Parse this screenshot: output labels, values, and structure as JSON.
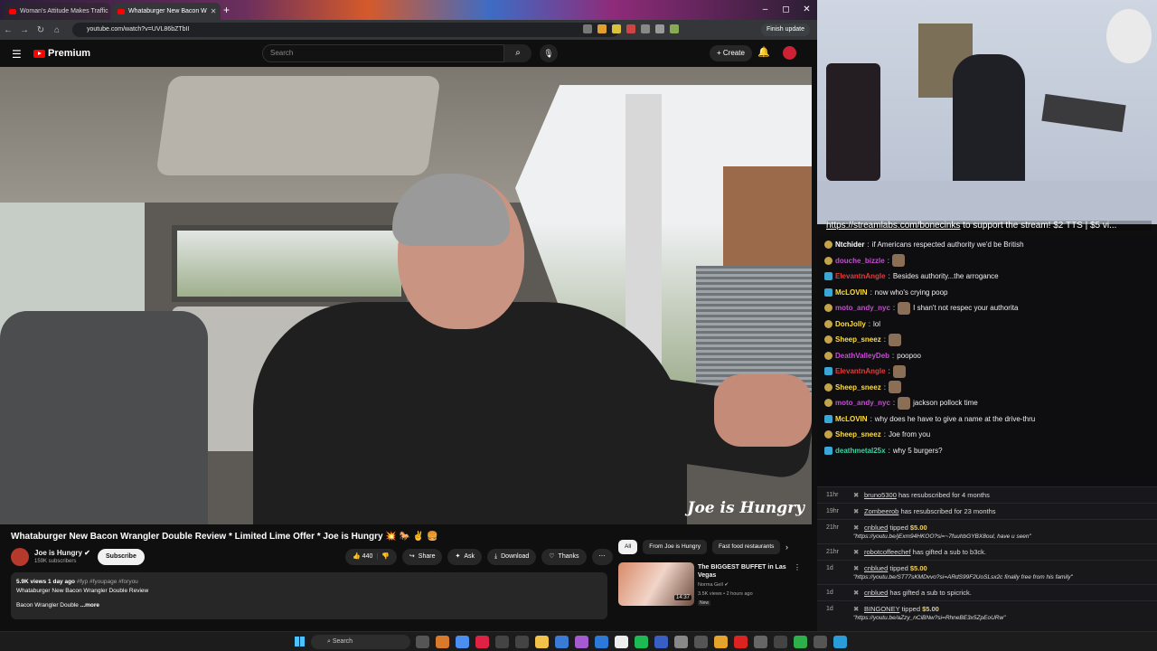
{
  "browser": {
    "tabs": [
      {
        "label": "Woman's Attitude Makes Traffic",
        "active": false
      },
      {
        "label": "Whataburger New Bacon W",
        "active": true
      }
    ],
    "url": "youtube.com/watch?v=UVL86bZTbII",
    "finish_update": "Finish update"
  },
  "youtube": {
    "brand": "Premium",
    "search_placeholder": "Search",
    "create_label": "Create",
    "video": {
      "watermark": "Joe is Hungry",
      "title": "Whataburger New Bacon Wrangler Double Review * Limited Lime Offer * Joe is Hungry 💥 🐎 ✌ 🍔",
      "channel": "Joe is Hungry",
      "subscribers": "159K subscribers",
      "subscribe_label": "Subscribe",
      "likes": "440",
      "share_label": "Share",
      "ask_label": "Ask",
      "download_label": "Download",
      "thanks_label": "Thanks",
      "views_line": "5.9K views  1 day ago",
      "hashtags": "#fyp #fyoupage #foryou",
      "desc_line1": "Whataburger New Bacon Wrangler Double Review",
      "desc_line2": "Bacon Wrangler Double",
      "more_label": "...more"
    },
    "chips": [
      "All",
      "From Joe is Hungry",
      "Fast food restaurants"
    ],
    "recommendation": {
      "title": "The BIGGEST BUFFET in Las Vegas",
      "channel": "Norma Gell",
      "views": "3.5K views • 2 hours ago",
      "badge": "New",
      "duration": "14:37"
    }
  },
  "stream": {
    "ticker_link": "https://streamlabs.com/bonecinks",
    "ticker_text": " to support the stream! $2 TTS | $5 vi..."
  },
  "chat": [
    {
      "user": "Ntchider",
      "color": "#ffffff",
      "badge": "b1",
      "text": "if Americans respected authority we'd be British"
    },
    {
      "user": "douche_bizzle",
      "color": "#c94bd6",
      "badge": "b1",
      "text": "",
      "emote": true
    },
    {
      "user": "ElevantnAngle",
      "color": "#e23c3c",
      "badge": "b2",
      "text": "Besides authority...the arrogance"
    },
    {
      "user": "McLOVIN",
      "color": "#ffdf3a",
      "badge": "b2",
      "text": "now who's crying poop"
    },
    {
      "user": "moto_andy_nyc",
      "color": "#c94bd6",
      "badge": "b1",
      "text": "I shan't not respec your authorita",
      "emote": true
    },
    {
      "user": "DonJolly",
      "color": "#ffdf3a",
      "badge": "b1",
      "text": "lol"
    },
    {
      "user": "Sheep_sneez",
      "color": "#ffdf3a",
      "badge": "b1",
      "text": "",
      "emote": true
    },
    {
      "user": "DeathValleyDeb",
      "color": "#c94bd6",
      "badge": "b1",
      "text": "poopoo"
    },
    {
      "user": "ElevantnAngle",
      "color": "#e23c3c",
      "badge": "b2",
      "text": "",
      "emote": true
    },
    {
      "user": "Sheep_sneez",
      "color": "#ffdf3a",
      "badge": "b1",
      "text": "",
      "emote": true
    },
    {
      "user": "moto_andy_nyc",
      "color": "#c94bd6",
      "badge": "b1",
      "text": "jackson pollock time",
      "emote": true
    },
    {
      "user": "McLOVIN",
      "color": "#ffdf3a",
      "badge": "b2",
      "text": "why does he have to give a name at the drive-thru"
    },
    {
      "user": "Sheep_sneez",
      "color": "#ffdf3a",
      "badge": "b1",
      "text": "Joe from you"
    },
    {
      "user": "deathmetal25x",
      "color": "#3ad6a0",
      "badge": "b2",
      "text": "why 5 burgers?"
    }
  ],
  "events": [
    {
      "time": "11hr",
      "user": "bruno5300",
      "text": " has resubscribed for 4 months"
    },
    {
      "time": "19hr",
      "user": "Zombeerob",
      "text": " has resubscribed for 23 months"
    },
    {
      "time": "21hr",
      "user": "cnblued",
      "text": " tipped ",
      "amount": "$5.00",
      "note": "\"https://youtu.be/jExm94HKOO?si=~7fuuhbGYBX8oul, have u seen\""
    },
    {
      "time": "21hr",
      "user": "robotcoffeechef",
      "text": " has gifted a sub to b3ck."
    },
    {
      "time": "1d",
      "user": "cnblued",
      "text": " tipped ",
      "amount": "$5.00",
      "note": "\"https://youtu.be/ST77sKMDvvo?si=ARdS99F2UoSLsx2c finally free from his family\""
    },
    {
      "time": "1d",
      "user": "cnblued",
      "text": " has gifted a sub to spicrick."
    },
    {
      "time": "1d",
      "user": "BINGONEY",
      "text": " tipped ",
      "amount": "$5.00",
      "note": "\"https://youtu.be/aZzy_nCiBNw?si=RhneBE3x5ZpEoURw\""
    }
  ],
  "taskbar": {
    "search_label": "Search"
  },
  "colors": {
    "accent": "#ff0000",
    "chat_bg": "#0e0e10",
    "page_bg": "#0f0f0f"
  }
}
